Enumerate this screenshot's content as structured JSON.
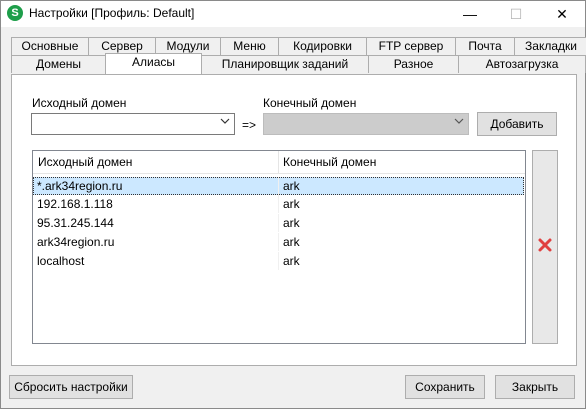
{
  "window": {
    "title": "Настройки [Профиль: Default]",
    "app_icon_letter": "S",
    "controls": {
      "minimize": "—",
      "maximize": "☐",
      "close": "✕"
    }
  },
  "tabs": {
    "row1": [
      "Основные",
      "Сервер",
      "Модули",
      "Меню",
      "Кодировки",
      "FTP сервер",
      "Почта",
      "Закладки"
    ],
    "row2": [
      "Домены",
      "Алиасы",
      "Планировщик заданий",
      "Разное",
      "Автозагрузка"
    ],
    "active": "Алиасы"
  },
  "aliases": {
    "source_label": "Исходный домен",
    "target_label": "Конечный домен",
    "source_value": "",
    "arrow": "=>",
    "target_value": "",
    "add_button": "Добавить",
    "columns": [
      "Исходный домен",
      "Конечный домен"
    ],
    "rows": [
      {
        "source": "*.ark34region.ru",
        "target": "ark",
        "selected": true
      },
      {
        "source": "192.168.1.118",
        "target": "ark",
        "selected": false
      },
      {
        "source": "95.31.245.144",
        "target": "ark",
        "selected": false
      },
      {
        "source": "ark34region.ru",
        "target": "ark",
        "selected": false
      },
      {
        "source": "localhost",
        "target": "ark",
        "selected": false
      }
    ],
    "delete_icon": "delete-x-icon",
    "delete_color": "#e04040"
  },
  "footer": {
    "reset_button": "Сбросить настройки",
    "save_button": "Сохранить",
    "close_button": "Закрыть"
  }
}
